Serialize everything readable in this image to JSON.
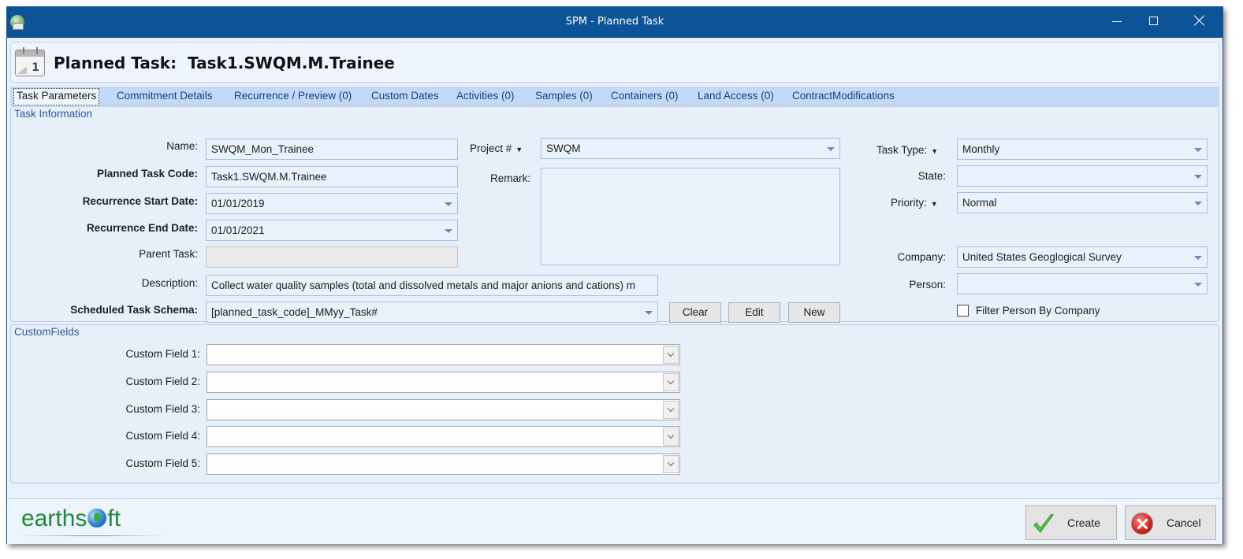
{
  "window": {
    "title": "SPM - Planned Task",
    "icon": "app-globe-icon",
    "controls": [
      "minimize",
      "maximize",
      "close"
    ]
  },
  "header": {
    "label": "Planned Task:",
    "code": "Task1.SWQM.M.Trainee",
    "icon": "calendar-icon"
  },
  "tabs": [
    {
      "label": "Task Parameters",
      "active": true
    },
    {
      "label": "Commitment Details"
    },
    {
      "label": "Recurrence / Preview (0)"
    },
    {
      "label": "Custom Dates"
    },
    {
      "label": "Activities (0)"
    },
    {
      "label": "Samples (0)"
    },
    {
      "label": "Containers (0)"
    },
    {
      "label": "Land Access (0)"
    },
    {
      "label": "ContractModifications"
    }
  ],
  "task_info": {
    "group_title": "Task Information",
    "name": {
      "label": "Name:",
      "value": "SWQM_Mon_Trainee"
    },
    "planned_task_code": {
      "label": "Planned Task Code:",
      "value": "Task1.SWQM.M.Trainee"
    },
    "recurrence_start": {
      "label": "Recurrence Start Date:",
      "value": "01/01/2019"
    },
    "recurrence_end": {
      "label": "Recurrence End Date:",
      "value": "01/01/2021"
    },
    "parent_task": {
      "label": "Parent Task:",
      "value": ""
    },
    "description": {
      "label": "Description:",
      "value": "Collect water quality samples (total and dissolved metals and major anions and cations) m"
    },
    "schema": {
      "label": "Scheduled Task Schema:",
      "value": "[planned_task_code]_MMyy_Task#"
    },
    "schema_buttons": {
      "clear": "Clear",
      "edit": "Edit",
      "new": "New"
    },
    "project": {
      "label": "Project #",
      "value": "SWQM"
    },
    "remark": {
      "label": "Remark:",
      "value": ""
    },
    "task_type": {
      "label": "Task Type:",
      "value": "Monthly"
    },
    "state": {
      "label": "State:",
      "value": ""
    },
    "priority": {
      "label": "Priority:",
      "value": "Normal"
    },
    "company": {
      "label": "Company:",
      "value": "United States Geoglogical Survey"
    },
    "person": {
      "label": "Person:",
      "value": ""
    },
    "filter_person": {
      "label": "Filter Person By Company",
      "checked": false
    }
  },
  "custom_fields": {
    "group_title": "CustomFields",
    "fields": [
      {
        "label": "Custom Field 1:",
        "value": ""
      },
      {
        "label": "Custom Field 2:",
        "value": ""
      },
      {
        "label": "Custom Field 3:",
        "value": ""
      },
      {
        "label": "Custom Field 4:",
        "value": ""
      },
      {
        "label": "Custom Field 5:",
        "value": ""
      }
    ]
  },
  "footer": {
    "logo_left": "earths",
    "logo_right": "ft",
    "create": "Create",
    "cancel": "Cancel"
  }
}
